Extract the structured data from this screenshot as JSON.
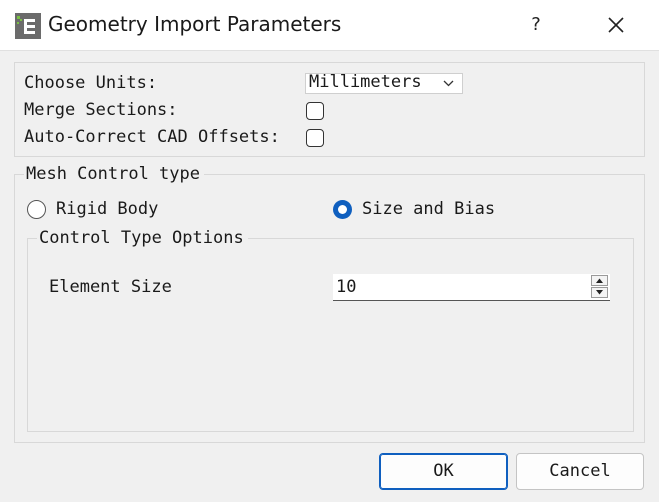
{
  "window": {
    "title": "Geometry Import Parameters",
    "help_label": "?",
    "icon": "app-logo-icon",
    "close_icon": "close-icon"
  },
  "import": {
    "units_label": "Choose Units:",
    "units_value": "Millimeters",
    "merge_label": "Merge Sections:",
    "merge_checked": false,
    "autocorrect_label": "Auto-Correct CAD Offsets:",
    "autocorrect_checked": false
  },
  "mesh": {
    "group_title": "Mesh Control type",
    "option_rigid": "Rigid Body",
    "option_size_bias": "Size and Bias",
    "selected": "Size and Bias",
    "options_group_title": "Control Type Options",
    "element_size_label": "Element Size",
    "element_size_value": "10"
  },
  "buttons": {
    "ok": "OK",
    "cancel": "Cancel"
  },
  "colors": {
    "accent": "#0f5fbf",
    "background": "#f0f0f0"
  }
}
